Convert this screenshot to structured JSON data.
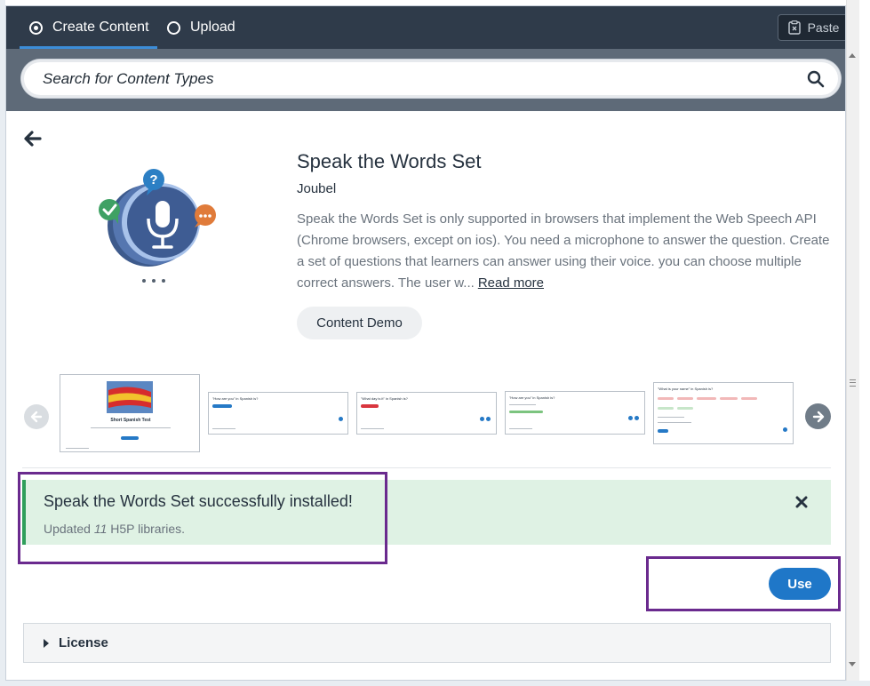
{
  "tabs": {
    "create_label": "Create Content",
    "upload_label": "Upload",
    "paste_label": "Paste"
  },
  "search": {
    "placeholder": "Search for Content Types"
  },
  "content_type": {
    "title": "Speak the Words Set",
    "owner": "Joubel",
    "description": "Speak the Words Set is only supported in browsers that implement the Web Speech API (Chrome browsers, except on ios). You need a microphone to answer the question. Create a set of questions that learners can answer using their voice. you can choose multiple correct answers. The user w...",
    "read_more": "Read more",
    "demo_label": "Content Demo"
  },
  "screenshots": {
    "thumb1_title": "Short Spanish Test",
    "thumb2_question": "\"How are you\" in Spanish is?",
    "thumb3_question": "\"What day is it\" in Spanish is?",
    "thumb4_question": "\"How are you\" in Spanish is?",
    "thumb5_question": "\"What is your name\" in Spanish is?"
  },
  "message": {
    "title": "Speak the Words Set successfully installed!",
    "sub_prefix": "Updated",
    "count": "11",
    "sub_suffix": "H5P libraries."
  },
  "use_label": "Use",
  "license_label": "License",
  "colors": {
    "tabbar": "#2f3b4a",
    "search_band": "#5e6a78",
    "accent": "#1f77c8",
    "success_bg": "#dff2e4",
    "success_border": "#2f9e5b",
    "annotation": "#6a2a8e"
  }
}
